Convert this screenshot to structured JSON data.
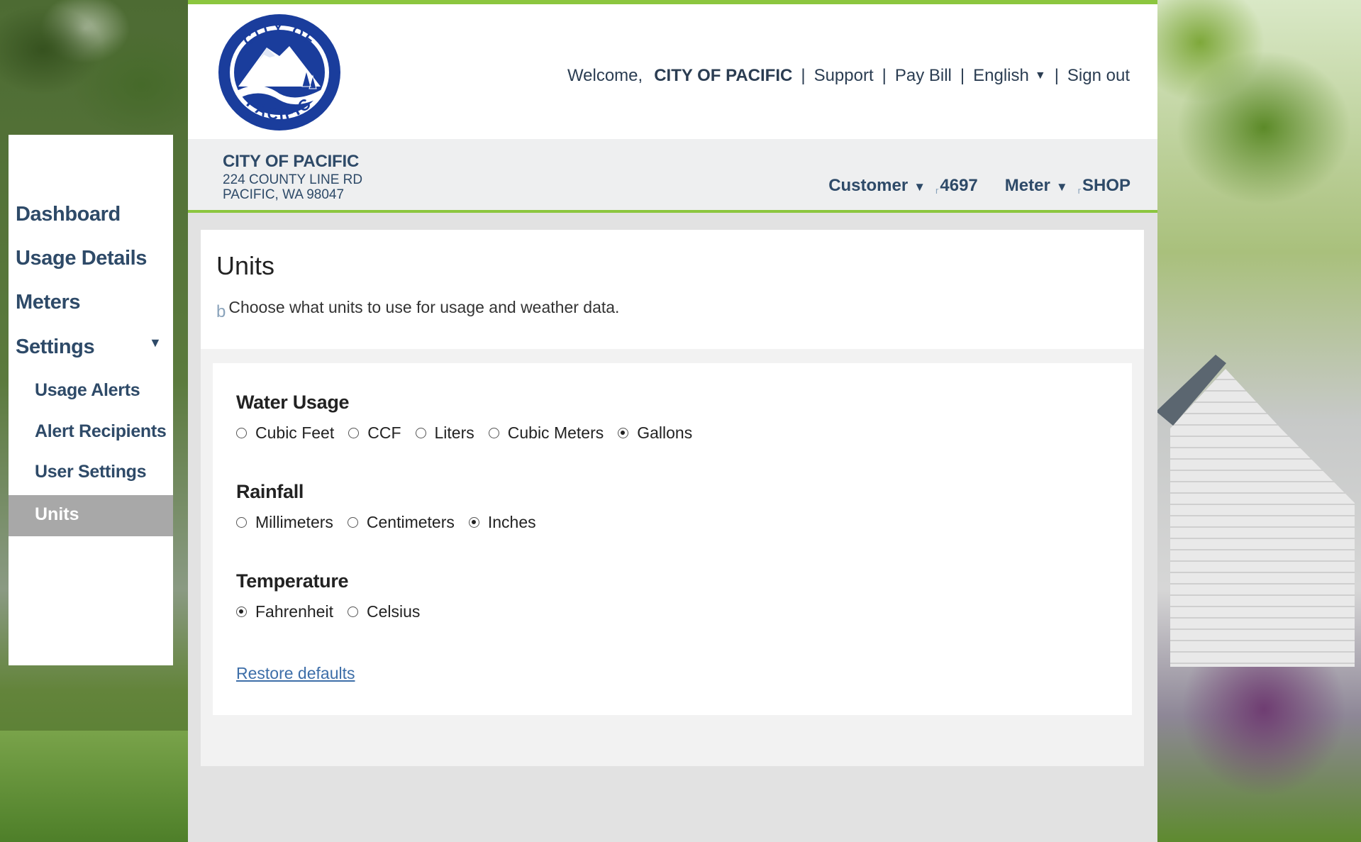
{
  "header": {
    "logo_text_top": "CITY OF",
    "logo_text_bottom": "PACIFIC",
    "welcome": "Welcome,",
    "org_name": "CITY OF PACIFIC",
    "sep": "|",
    "support": "Support",
    "pay_bill": "Pay Bill",
    "language": "English",
    "sign_out": "Sign out"
  },
  "account": {
    "name": "CITY OF PACIFIC",
    "address_line1": "224 COUNTY LINE RD",
    "address_line2": "PACIFIC, WA 98047",
    "customer_label": "Customer",
    "customer_value": "4697",
    "meter_label": "Meter",
    "meter_value": "SHOP",
    "mark": "r"
  },
  "sidebar": {
    "items": [
      {
        "label": "Dashboard"
      },
      {
        "label": "Usage Details"
      },
      {
        "label": "Meters"
      },
      {
        "label": "Settings"
      }
    ],
    "sub_items": [
      {
        "label": "Usage Alerts"
      },
      {
        "label": "Alert Recipients"
      },
      {
        "label": "User Settings"
      },
      {
        "label": "Units",
        "active": true
      }
    ]
  },
  "page": {
    "title": "Units",
    "desc_mark": "b",
    "description": "Choose what units to use for usage and weather data.",
    "restore_label": "Restore defaults"
  },
  "groups": {
    "water": {
      "title": "Water Usage",
      "options": [
        "Cubic Feet",
        "CCF",
        "Liters",
        "Cubic Meters",
        "Gallons"
      ],
      "selected": "Gallons"
    },
    "rainfall": {
      "title": "Rainfall",
      "options": [
        "Millimeters",
        "Centimeters",
        "Inches"
      ],
      "selected": "Inches"
    },
    "temperature": {
      "title": "Temperature",
      "options": [
        "Fahrenheit",
        "Celsius"
      ],
      "selected": "Fahrenheit"
    }
  },
  "icons": {
    "caret": "▼",
    "nav_caret": "▼"
  },
  "colors": {
    "accent_green": "#8cc63f",
    "nav_blue": "#2e4a68",
    "link_blue": "#3d6ea8",
    "logo_blue": "#1a3d9c"
  }
}
